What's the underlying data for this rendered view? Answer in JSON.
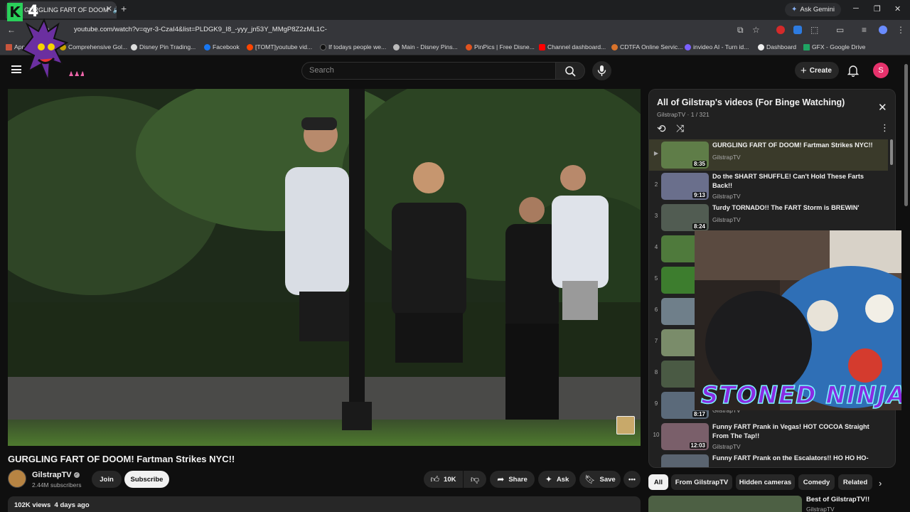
{
  "browser": {
    "tab_title": "GURGLING FART OF DOOM",
    "new_tab": "+",
    "ask_gemini": "Ask Gemini",
    "url": "youtube.com/watch?v=qyr-3-CzaI4&list=PLDGK9_I8_-yyy_jn53Y_MMgP8Z2zML1C-",
    "bookmarks": [
      {
        "label": "App",
        "color": "#9aa0a6"
      },
      {
        "label": "Comprehensive Gol...",
        "color": "#c8a200"
      },
      {
        "label": "Disney Pin Trading...",
        "color": "#dddddd"
      },
      {
        "label": "Facebook",
        "color": "#1877f2"
      },
      {
        "label": "[TOMT]youtube vid...",
        "color": "#ff4500"
      },
      {
        "label": "If todays people we...",
        "color": "#111111"
      },
      {
        "label": "Main - Disney Pins...",
        "color": "#bbbbbb"
      },
      {
        "label": "PinPics | Free Disne...",
        "color": "#e0531f"
      },
      {
        "label": "Channel dashboard...",
        "color": "#ff0000"
      },
      {
        "label": "CDTFA Online Servic...",
        "color": "#d9732b"
      },
      {
        "label": "invideo AI - Turn id...",
        "color": "#7b61ff"
      },
      {
        "label": "Dashboard",
        "color": "#eeeeee"
      },
      {
        "label": "GFX - Google Drive",
        "color": "#1fa463"
      }
    ]
  },
  "overlay": {
    "logo_k": "K",
    "logo_four": "4",
    "webcam_label": "STONED NINJA"
  },
  "masthead": {
    "search_placeholder": "Search",
    "create_label": "Create",
    "avatar_letter": "S"
  },
  "video": {
    "title": "GURGLING FART OF DOOM! Fartman Strikes NYC!!",
    "channel": "GilstrapTV",
    "subscribers": "2.44M subscribers",
    "join": "Join",
    "subscribe": "Subscribe",
    "likes": "10K",
    "share": "Share",
    "ask": "Ask",
    "save": "Save",
    "views": "102K views",
    "age": "4 days ago"
  },
  "playlist": {
    "title": "All of Gilstrap's videos (For Binge Watching)",
    "owner": "GilstrapTV",
    "position": "1 / 321",
    "items": [
      {
        "index": "▶",
        "title": "GURGLING FART OF DOOM! Fartman Strikes NYC!!",
        "channel": "GilstrapTV",
        "duration": "8:35"
      },
      {
        "index": "2",
        "title": "Do the SHART SHUFFLE! Can't Hold These Farts Back!!",
        "channel": "GilstrapTV",
        "duration": "9:13"
      },
      {
        "index": "3",
        "title": "Turdy TORNADO!! The FART Storm is BREWIN'",
        "channel": "GilstrapTV",
        "duration": "8:24"
      },
      {
        "index": "4",
        "title": "",
        "channel": "",
        "duration": ""
      },
      {
        "index": "5",
        "title": "",
        "channel": "",
        "duration": ""
      },
      {
        "index": "6",
        "title": "",
        "channel": "",
        "duration": ""
      },
      {
        "index": "7",
        "title": "",
        "channel": "",
        "duration": ""
      },
      {
        "index": "8",
        "title": "",
        "channel": "",
        "duration": ""
      },
      {
        "index": "9",
        "title": "",
        "channel": "GilstrapTV",
        "duration": "8:17"
      },
      {
        "index": "10",
        "title": "Funny FART Prank in Vegas! HOT COCOA Straight From The Tap!!",
        "channel": "GilstrapTV",
        "duration": "12:03"
      },
      {
        "index": "",
        "title": "Funny FART Prank on the Escalators!! HO HO HO-",
        "channel": "",
        "duration": ""
      }
    ]
  },
  "chips": [
    "All",
    "From GilstrapTV",
    "Hidden cameras",
    "Comedy",
    "Related"
  ],
  "recommendation": {
    "title": "Best of GilstrapTV!!",
    "channel": "GilstrapTV"
  }
}
